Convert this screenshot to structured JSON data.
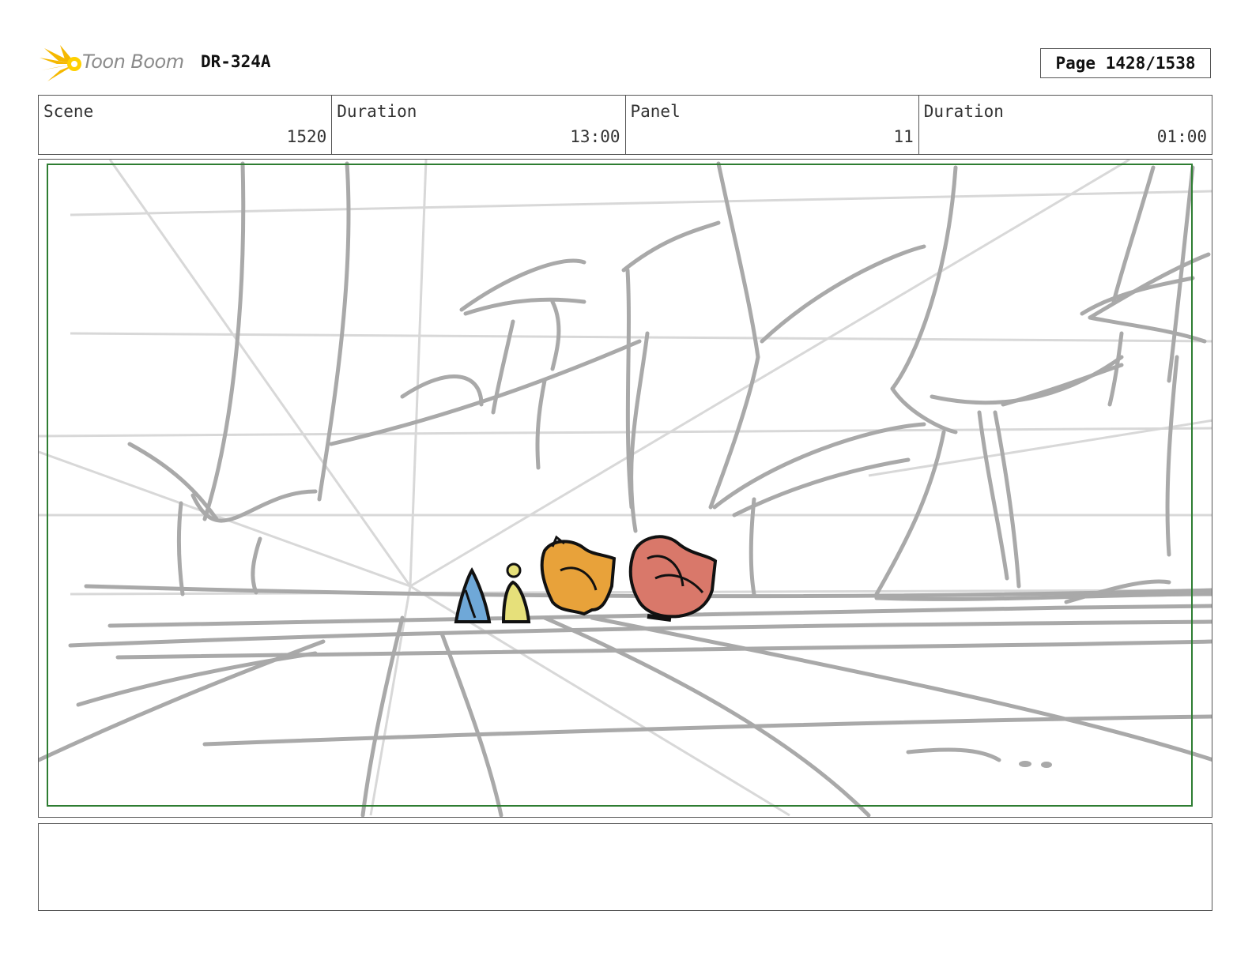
{
  "header": {
    "logo_text": "Toon Boom",
    "doc_id": "DR-324A",
    "page_label": "Page 1428/1538"
  },
  "info": {
    "scene_label": "Scene",
    "scene_value": "1520",
    "scene_duration_label": "Duration",
    "scene_duration_value": "13:00",
    "panel_label": "Panel",
    "panel_value": "11",
    "panel_duration_label": "Duration",
    "panel_duration_value": "01:00"
  },
  "colors": {
    "safe_frame": "#2e7d32",
    "sketch_gray": "#a9a9a9",
    "char_blue": "#6fa8d8",
    "char_yellow": "#e6e07a",
    "char_orange": "#e8a23a",
    "char_red": "#d9786a"
  },
  "notes": {
    "text": ""
  }
}
